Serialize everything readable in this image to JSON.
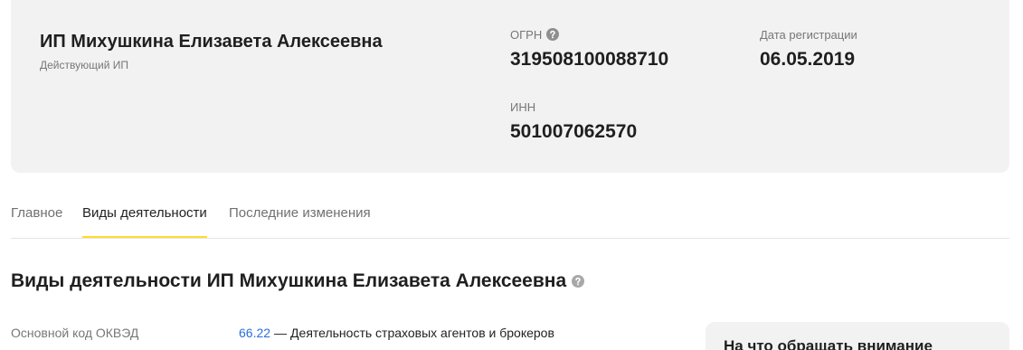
{
  "company": {
    "name": "ИП Михушкина Елизавета Алексеевна",
    "status": "Действующий ИП"
  },
  "requisites": {
    "ogrn": {
      "label": "ОГРН",
      "value": "319508100088710",
      "icon": "question-circle-icon"
    },
    "registration_date": {
      "label": "Дата регистрации",
      "value": "06.05.2019"
    },
    "inn": {
      "label": "ИНН",
      "value": "501007062570"
    }
  },
  "tabs": [
    {
      "label": "Главное",
      "active": false
    },
    {
      "label": "Виды деятельности",
      "active": true
    },
    {
      "label": "Последние изменения",
      "active": false
    }
  ],
  "activities": {
    "heading": "Виды деятельности ИП Михушкина Елизавета Алексеевна",
    "icon": "question-circle-icon",
    "main_okved": {
      "label": "Основной код ОКВЭД",
      "code": "66.22",
      "separator": "—",
      "description": "Деятельность страховых агентов и брокеров"
    }
  },
  "aside": {
    "title": "На что обращать внимание"
  },
  "colors": {
    "card_background": "#f2f2f2",
    "accent": "#ffdd2d",
    "link": "#2a6fdb"
  }
}
